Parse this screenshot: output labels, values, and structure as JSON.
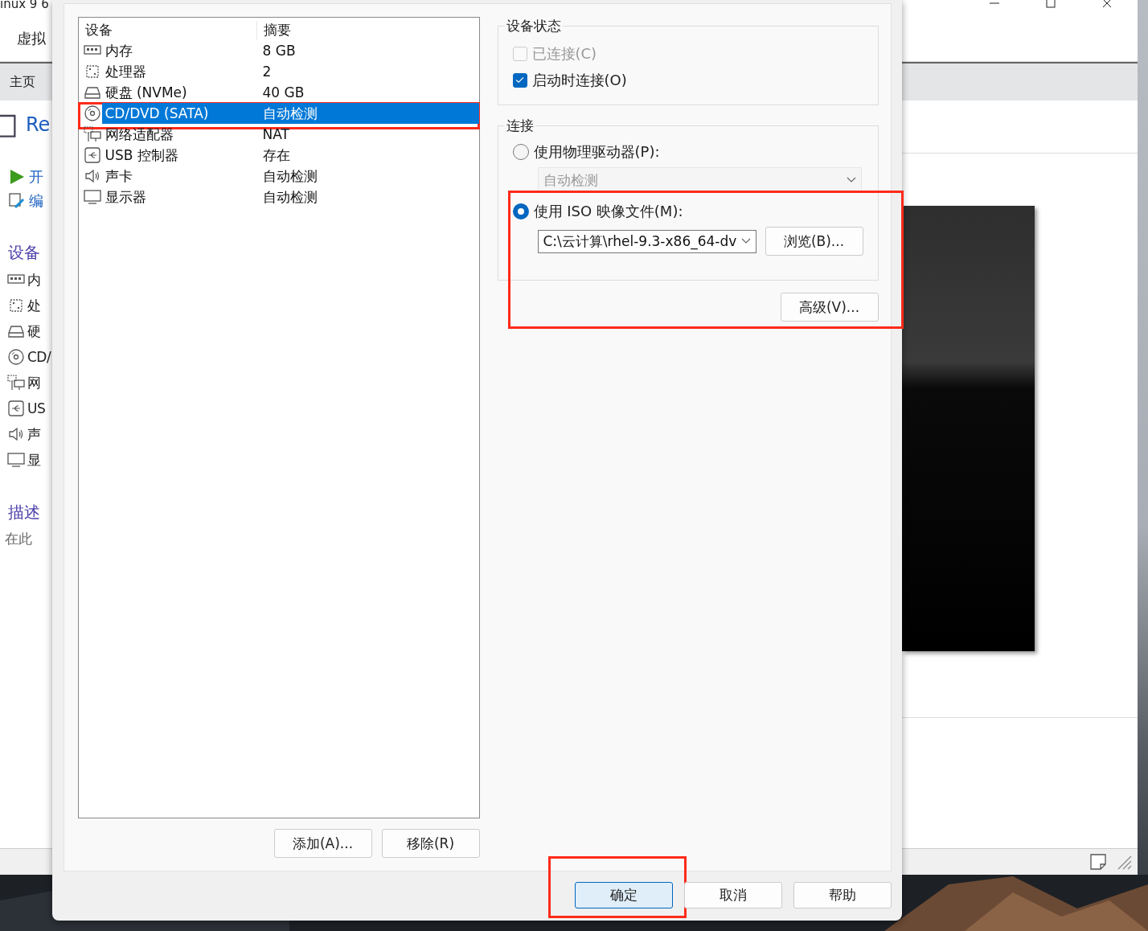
{
  "background_window": {
    "title": "inux 9 6",
    "menu": "虚拟",
    "tab": "主页",
    "vm_name": "Re",
    "actions": [
      {
        "label": "开",
        "kind": "play"
      },
      {
        "label": "编",
        "kind": "edit"
      }
    ],
    "devices_heading": "设备",
    "devices": [
      {
        "label": "内",
        "kind": "memory"
      },
      {
        "label": "处",
        "kind": "cpu"
      },
      {
        "label": "硬",
        "kind": "disk"
      },
      {
        "label": "CD/",
        "kind": "cdrom"
      },
      {
        "label": "网",
        "kind": "network"
      },
      {
        "label": "US",
        "kind": "usb"
      },
      {
        "label": "声",
        "kind": "sound"
      },
      {
        "label": "显",
        "kind": "display"
      }
    ],
    "description_heading": "描述",
    "description": "在此"
  },
  "dialog": {
    "device_table": {
      "columns": [
        "设备",
        "摘要"
      ],
      "rows": [
        {
          "device": "内存",
          "summary": "8 GB",
          "kind": "memory",
          "selected": false,
          "highlighted": false
        },
        {
          "device": "处理器",
          "summary": "2",
          "kind": "cpu",
          "selected": false,
          "highlighted": false
        },
        {
          "device": "硬盘 (NVMe)",
          "summary": "40 GB",
          "kind": "disk",
          "selected": false,
          "highlighted": false
        },
        {
          "device": "CD/DVD (SATA)",
          "summary": "自动检测",
          "kind": "cdrom",
          "selected": true,
          "highlighted": true
        },
        {
          "device": "网络适配器",
          "summary": "NAT",
          "kind": "network",
          "selected": false,
          "highlighted": false
        },
        {
          "device": "USB 控制器",
          "summary": "存在",
          "kind": "usb",
          "selected": false,
          "highlighted": false
        },
        {
          "device": "声卡",
          "summary": "自动检测",
          "kind": "sound",
          "selected": false,
          "highlighted": false
        },
        {
          "device": "显示器",
          "summary": "自动检测",
          "kind": "display",
          "selected": false,
          "highlighted": false
        }
      ]
    },
    "list_buttons": [
      "添加(A)...",
      "移除(R)"
    ],
    "device_status": {
      "title": "设备状态",
      "options": [
        {
          "label": "已连接(C)",
          "checked": false,
          "disabled": true
        },
        {
          "label": "启动时连接(O)",
          "checked": true,
          "disabled": false
        }
      ]
    },
    "connection": {
      "title": "连接",
      "physical": {
        "label": "使用物理驱动器(P):",
        "selected": false,
        "dropdown": {
          "value": "自动检测",
          "disabled": true
        }
      },
      "iso": {
        "label": "使用 ISO 映像文件(M):",
        "selected": true,
        "highlighted": true,
        "path": "C:\\云计算\\rhel-9.3-x86_64-dv",
        "browse": "浏览(B)..."
      }
    },
    "advanced_button": "高级(V)...",
    "buttons": [
      {
        "label": "确定",
        "default": true,
        "highlighted": true
      },
      {
        "label": "取消",
        "default": false,
        "highlighted": false
      },
      {
        "label": "帮助",
        "default": false,
        "highlighted": false
      }
    ]
  }
}
